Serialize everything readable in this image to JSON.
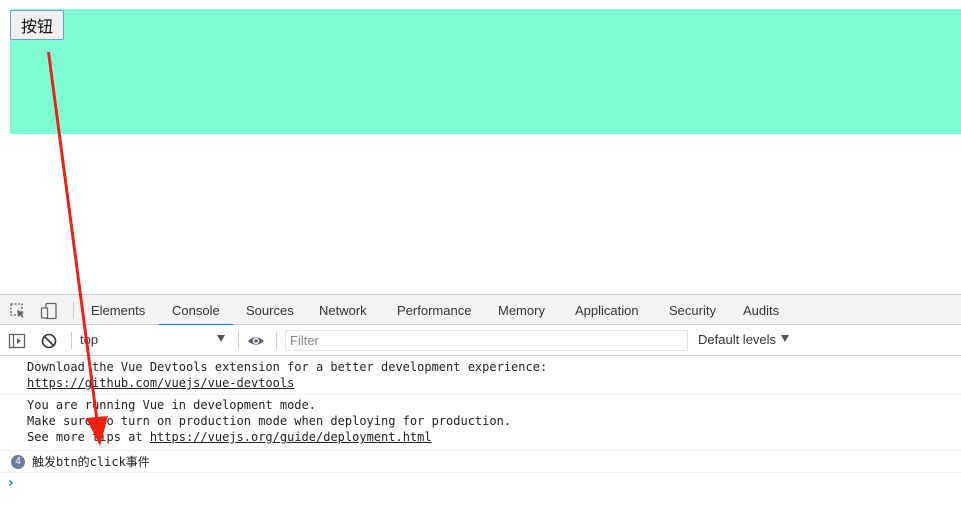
{
  "page": {
    "button_label": "按钮",
    "box_color": "#7fffd4"
  },
  "devtools": {
    "left_icons": [
      "inspect-element-icon",
      "device-toolbar-icon"
    ],
    "tabs": [
      {
        "label": "Elements",
        "active": false
      },
      {
        "label": "Console",
        "active": true
      },
      {
        "label": "Sources",
        "active": false
      },
      {
        "label": "Network",
        "active": false
      },
      {
        "label": "Performance",
        "active": false
      },
      {
        "label": "Memory",
        "active": false
      },
      {
        "label": "Application",
        "active": false
      },
      {
        "label": "Security",
        "active": false
      },
      {
        "label": "Audits",
        "active": false
      }
    ],
    "accent_color": "#1a73e8",
    "toolbar": {
      "context": "top",
      "filter_placeholder": "Filter",
      "levels_label": "Default levels",
      "icons": [
        "sidebar-toggle-icon",
        "clear-console-icon",
        "live-expression-eye-icon"
      ]
    },
    "messages": [
      {
        "lines": [
          "Download the Vue Devtools extension for a better development experience:"
        ],
        "link": "https://github.com/vuejs/vue-devtools"
      },
      {
        "lines": [
          "You are running Vue in development mode.",
          "Make sure to turn on production mode when deploying for production."
        ],
        "prefix": "See more tips at ",
        "link": "https://vuejs.org/guide/deployment.html"
      },
      {
        "count": "4",
        "text": "触发btn的click事件"
      }
    ],
    "prompt_symbol": "›"
  },
  "annotation": {
    "arrow_color": "#ee2211"
  }
}
